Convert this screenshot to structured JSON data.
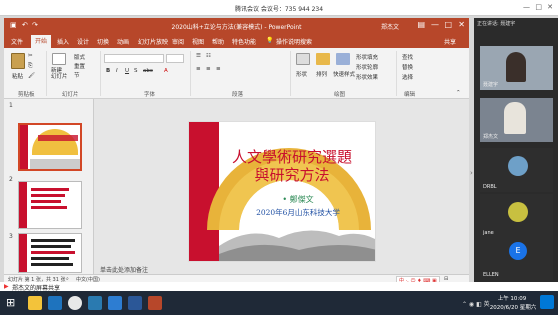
{
  "meeting": {
    "title": "腾讯会议 会议号：735 944 234",
    "speaker_prefix": "正在讲话: 聂建宇",
    "screen_share_label": "郑杰文的屏幕共享",
    "participants": [
      {
        "name": "聂建宇",
        "kind": "video"
      },
      {
        "name": "郑杰文",
        "kind": "video"
      },
      {
        "name": "DRBL",
        "kind": "landscape"
      },
      {
        "name": "jane",
        "kind": "flower"
      },
      {
        "name": "ELLEN",
        "kind": "avatar",
        "initial": "E"
      }
    ]
  },
  "powerpoint": {
    "title": "2020山科+立论与方法(兼容模式) - PowerPoint",
    "user": "郑杰文",
    "tabs": [
      "文件",
      "开始",
      "插入",
      "设计",
      "切换",
      "动画",
      "幻灯片放映",
      "审阅",
      "视图",
      "帮助",
      "特色功能",
      "操作说明搜索"
    ],
    "share_label": "共享",
    "active_tab": "开始",
    "ribbon": {
      "paste": "粘贴",
      "clipboard_group": "剪贴板",
      "new_slide": "新建\n幻灯片",
      "layout": "版式",
      "reset": "重置",
      "section": "节",
      "slides_group": "幻灯片",
      "font_group": "字体",
      "paragraph_group": "段落",
      "shape": "形状",
      "arrange": "排列",
      "quick_styles": "快速样式",
      "drawing_group": "绘图",
      "find": "查找",
      "replace": "替换",
      "select": "选择",
      "editing_group": "编辑",
      "shape_fill": "形状填充",
      "shape_outline": "形状轮廓",
      "shape_effect": "形状效果"
    },
    "slide": {
      "title_line1": "人文學術研究選題",
      "title_line2": "與研究方法",
      "author": "• 鄭傑文",
      "date_place": "2020年6月山东科技大学"
    },
    "thumbs": [
      {
        "num": "1"
      },
      {
        "num": "2"
      },
      {
        "num": "3"
      }
    ],
    "notes_placeholder": "单击此处添加备注",
    "status": {
      "slide_info": "幻灯片 第 1 张，共 31 张",
      "language": "中文(中国)"
    }
  },
  "taskbar": {
    "time": "上午 10:09",
    "date": "2020/6/20 星期六"
  },
  "colors": {
    "ppt_accent": "#b7472a",
    "slide_title_red": "#c8102e",
    "slide_author_green": "#2e8b57",
    "slide_date_blue": "#1f4fa3"
  }
}
